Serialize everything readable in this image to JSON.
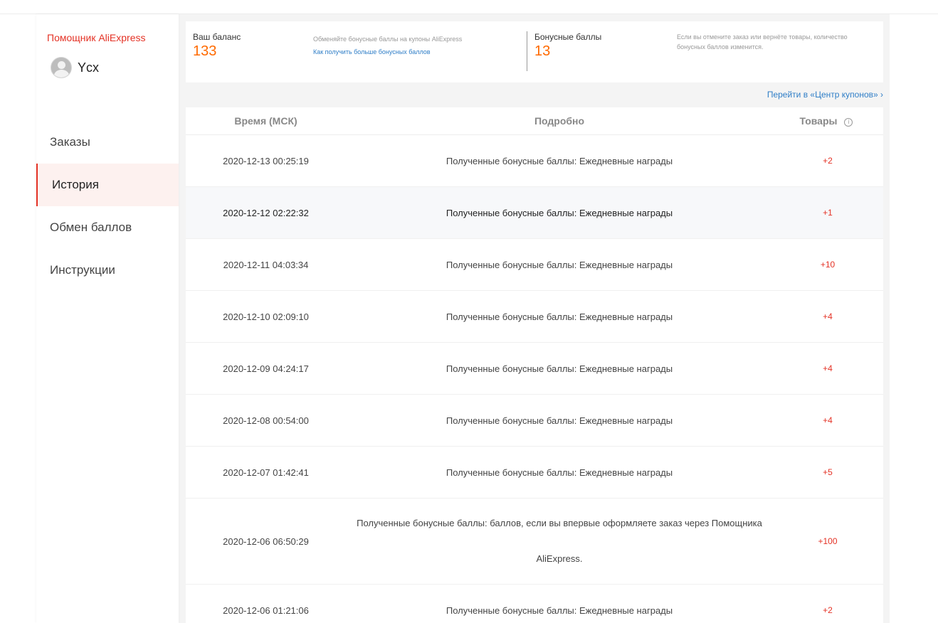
{
  "sidebar": {
    "brand": "Помощник AliExpress",
    "username": "Ycx",
    "items": [
      {
        "label": "Заказы"
      },
      {
        "label": "История"
      },
      {
        "label": "Обмен баллов"
      },
      {
        "label": "Инструкции"
      }
    ]
  },
  "balance": {
    "label": "Ваш баланс",
    "value": "133",
    "exchange_note": "Обменяйте бонусные баллы на купоны AliExpress",
    "more_link": "Как получить больше бонусных баллов",
    "points_label": "Бонусные баллы",
    "points_value": "13",
    "cancel_note": "Если вы отмените заказ или вернёте товары, количество бонусных баллов изменится."
  },
  "coupon_center_link": "Перейти в «Центр купонов» ›",
  "table": {
    "headers": {
      "time": "Время (МСК)",
      "detail": "Подробно",
      "goods": "Товары",
      "info": "i"
    },
    "rows": [
      {
        "time": "2020-12-13 00:25:19",
        "detail": "Полученные бонусные баллы: Ежедневные награды",
        "points": "+2"
      },
      {
        "time": "2020-12-12 02:22:32",
        "detail": "Полученные бонусные баллы: Ежедневные награды",
        "points": "+1"
      },
      {
        "time": "2020-12-11 04:03:34",
        "detail": "Полученные бонусные баллы: Ежедневные награды",
        "points": "+10"
      },
      {
        "time": "2020-12-10 02:09:10",
        "detail": "Полученные бонусные баллы: Ежедневные награды",
        "points": "+4"
      },
      {
        "time": "2020-12-09 04:24:17",
        "detail": "Полученные бонусные баллы: Ежедневные награды",
        "points": "+4"
      },
      {
        "time": "2020-12-08 00:54:00",
        "detail": "Полученные бонусные баллы: Ежедневные награды",
        "points": "+4"
      },
      {
        "time": "2020-12-07 01:42:41",
        "detail": "Полученные бонусные баллы: Ежедневные награды",
        "points": "+5"
      },
      {
        "time": "2020-12-06 06:50:29",
        "detail": "Полученные бонусные баллы: баллов, если вы впервые оформляете заказ через Помощника AliExpress.",
        "points": "+100"
      },
      {
        "time": "2020-12-06 01:21:06",
        "detail": "Полученные бонусные баллы: Ежедневные награды",
        "points": "+2"
      }
    ]
  },
  "colors": {
    "accent": "#e43225",
    "balance": "#ff6a00",
    "link": "#2f7ec7"
  }
}
